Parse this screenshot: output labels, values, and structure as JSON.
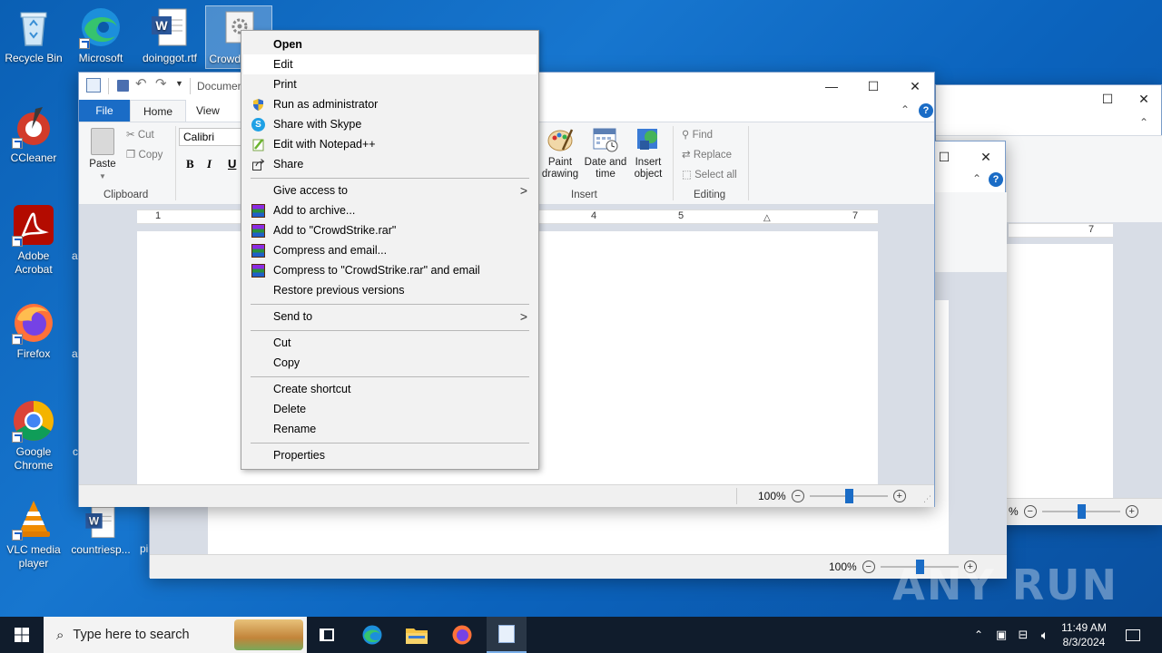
{
  "desktop": {
    "icons": [
      {
        "label": "Recycle Bin"
      },
      {
        "label": "Microsoft Edge"
      },
      {
        "label": "doinggot.rtf"
      },
      {
        "label": "CrowdStrike"
      },
      {
        "label": "CCleaner"
      },
      {
        "label": "Adobe Acrobat"
      },
      {
        "label": "Firefox"
      },
      {
        "label": "Google Chrome"
      },
      {
        "label": "VLC media player"
      },
      {
        "label": "countriesp..."
      }
    ],
    "partial_labels": [
      "a",
      "a",
      "c",
      "pi"
    ]
  },
  "wordpad_front": {
    "title": "Documen",
    "tabs": {
      "file": "File",
      "home": "Home",
      "view": "View"
    },
    "clipboard": {
      "paste": "Paste",
      "cut": "Cut",
      "copy": "Copy",
      "group": "Clipboard"
    },
    "font": {
      "name": "Calibri",
      "bold": "B",
      "italic": "I",
      "underline": "U"
    },
    "insert": {
      "paint": "Paint drawing",
      "datetime": "Date and time",
      "object": "Insert object",
      "group": "Insert"
    },
    "editing": {
      "find": "Find",
      "replace": "Replace",
      "select_all": "Select all",
      "group": "Editing"
    },
    "ruler": {
      "n1": "1",
      "n4": "4",
      "n5": "5",
      "n7": "7"
    },
    "zoom": {
      "level": "100%",
      "minus": "−",
      "plus": "+",
      "fraction": 0.5
    }
  },
  "wordpad_back": {
    "zoom": {
      "level": "100%",
      "minus": "−",
      "plus": "+",
      "fraction": 0.5
    }
  },
  "wordpad_far": {
    "ruler_num": "7",
    "zoom_partial": "%",
    "plus": "+",
    "minus": "−"
  },
  "context_menu": {
    "items": [
      {
        "label": "Open",
        "bold": true
      },
      {
        "label": "Edit"
      },
      {
        "label": "Print"
      },
      {
        "label": "Run as administrator",
        "icon": "shield-icon"
      },
      {
        "label": "Share with Skype",
        "icon": "skype-icon"
      },
      {
        "label": "Edit with Notepad++",
        "icon": "notepadpp-icon"
      },
      {
        "label": "Share",
        "icon": "share-icon"
      },
      {
        "label": "Give access to",
        "submenu": true
      },
      {
        "label": "Add to archive...",
        "icon": "winrar-icon"
      },
      {
        "label": "Add to \"CrowdStrike.rar\"",
        "icon": "winrar-icon"
      },
      {
        "label": "Compress and email...",
        "icon": "winrar-icon"
      },
      {
        "label": "Compress to \"CrowdStrike.rar\" and email",
        "icon": "winrar-icon"
      },
      {
        "label": "Restore previous versions"
      },
      {
        "label": "Send to",
        "submenu": true
      },
      {
        "label": "Cut"
      },
      {
        "label": "Copy"
      },
      {
        "label": "Create shortcut"
      },
      {
        "label": "Delete"
      },
      {
        "label": "Rename"
      },
      {
        "label": "Properties"
      }
    ],
    "submenu_glyph": ">"
  },
  "taskbar": {
    "search_placeholder": "Type here to search",
    "time": "11:49 AM",
    "date": "8/3/2024"
  },
  "watermark": "ANY RUN"
}
